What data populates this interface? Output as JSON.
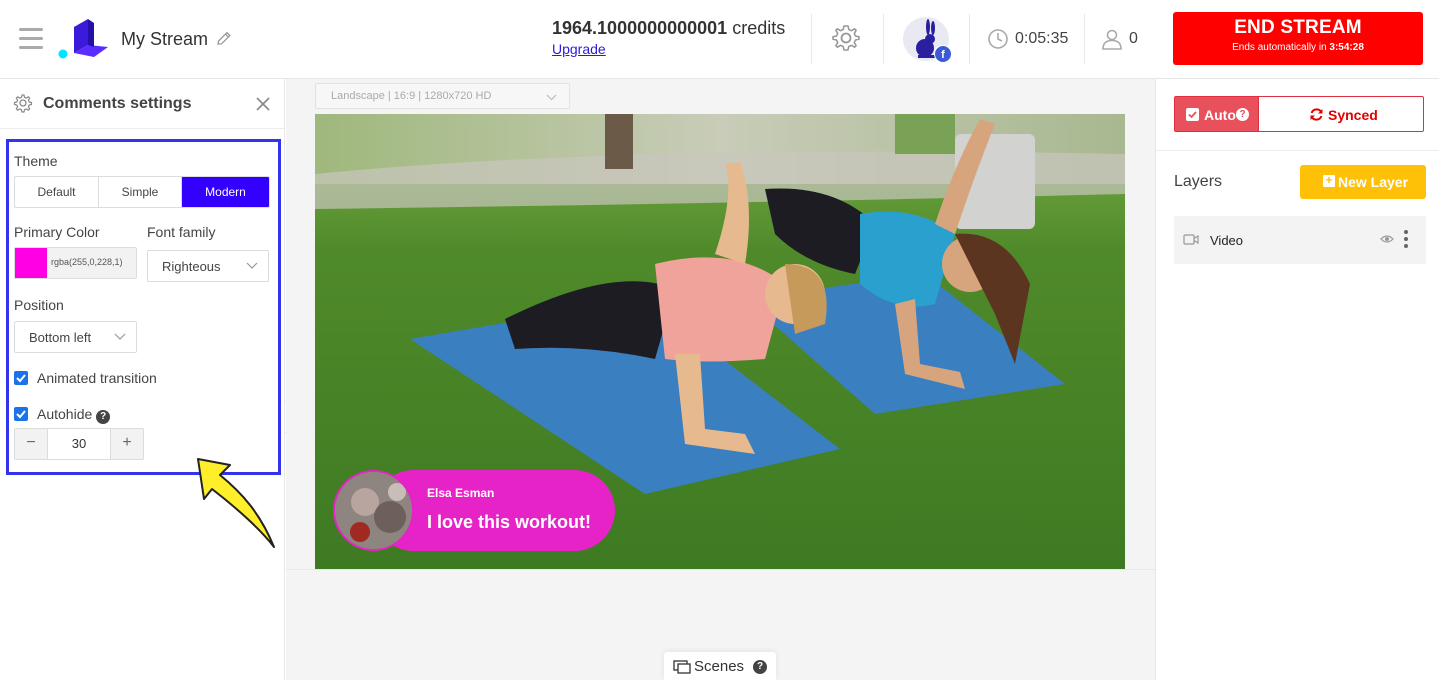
{
  "header": {
    "stream_title": "My Stream",
    "credits_value": "1964.1000000000001",
    "credits_unit": "credits",
    "upgrade_label": "Upgrade",
    "timer": "0:05:35",
    "viewer_count": "0",
    "end_stream_label": "END STREAM",
    "end_auto_prefix": "Ends automatically in",
    "end_auto_time": "3:54:28",
    "avatar_badge": "f"
  },
  "left_panel": {
    "title": "Comments settings",
    "theme_label": "Theme",
    "theme_options": [
      "Default",
      "Simple",
      "Modern"
    ],
    "theme_selected": "Modern",
    "primary_color_label": "Primary Color",
    "primary_color_value": "rgba(255,0,228,1)",
    "font_family_label": "Font family",
    "font_family_value": "Righteous",
    "position_label": "Position",
    "position_value": "Bottom left",
    "animated_transition_label": "Animated transition",
    "animated_transition_checked": true,
    "autohide_label": "Autohide",
    "autohide_checked": true,
    "autohide_help": "?",
    "autohide_value": "30",
    "stepper_minus": "−",
    "stepper_plus": "+"
  },
  "center": {
    "layout_select": "Landscape | 16:9 | 1280x720 HD",
    "comment_name": "Elsa Esman",
    "comment_text": "I love this workout!",
    "scenes_label": "Scenes",
    "scenes_help": "?"
  },
  "right_panel": {
    "auto_label": "Auto",
    "auto_help": "?",
    "synced_label": "Synced",
    "layers_title": "Layers",
    "new_layer_label": "New Layer",
    "layers": [
      {
        "name": "Video"
      }
    ]
  },
  "colors": {
    "accent_blue": "#3300ff",
    "end_stream_red": "#ff0000",
    "comment_pink": "#e623c6",
    "new_layer_yellow": "#ffc107",
    "highlight_box": "#3333ee"
  }
}
